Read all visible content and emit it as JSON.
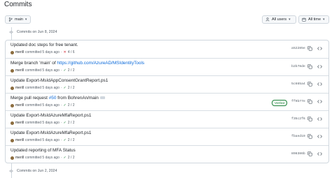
{
  "page": {
    "title": "Commits"
  },
  "toolbar": {
    "branch_label": "main",
    "users_label": "All users",
    "time_label": "All time"
  },
  "groups": [
    {
      "label": "Commits on Jun 8, 2024"
    },
    {
      "label": "Commits on Jun 2, 2024"
    }
  ],
  "commits": [
    {
      "message": "Updated doc steps for free tenant.",
      "author": "merill",
      "time": "committed 5 days ago",
      "status": "4 / 6",
      "status_kind": "fail",
      "sha": "a52285e"
    },
    {
      "message_prefix": "Merge branch 'main' of ",
      "link": "https://github.com/AzureAD/MSIdentityTools",
      "author": "merill",
      "time": "committed 5 days ago",
      "status": "2 / 2",
      "status_kind": "pass",
      "sha": "b2b78de"
    },
    {
      "message": "Update Export-MsIdAppConsentGrantReport.ps1",
      "author": "merill",
      "time": "committed 5 days ago",
      "status": "2 / 2",
      "status_kind": "pass",
      "sha": "5c665a4"
    },
    {
      "message_prefix": "Merge pull request ",
      "pr": "#50",
      "message_suffix": " from BohrenAn/main",
      "author": "merill",
      "time": "committed 5 days ago",
      "status": "2 / 2",
      "status_kind": "pass",
      "sha": "ff9b77e",
      "badge": "Verified"
    },
    {
      "message": "Update Export-MsIdAzureMfaReport.ps1",
      "author": "merill",
      "time": "committed 5 days ago",
      "status": "2 / 2",
      "status_kind": "pass",
      "sha": "f35c2f6"
    },
    {
      "message": "Update Export-MsIdAzureMfaReport.ps1",
      "author": "merill",
      "time": "committed 5 days ago",
      "status": "2 / 2",
      "status_kind": "pass",
      "sha": "fbaed19"
    },
    {
      "message": "Updated reporting of MFA Status",
      "author": "merill",
      "time": "committed 5 days ago",
      "status": "2 / 2",
      "status_kind": "pass",
      "sha": "898386b"
    }
  ],
  "colors": {
    "link": "#0969da",
    "fail": "#cf222e",
    "pass": "#1a7f37",
    "border": "#d0d7de"
  }
}
